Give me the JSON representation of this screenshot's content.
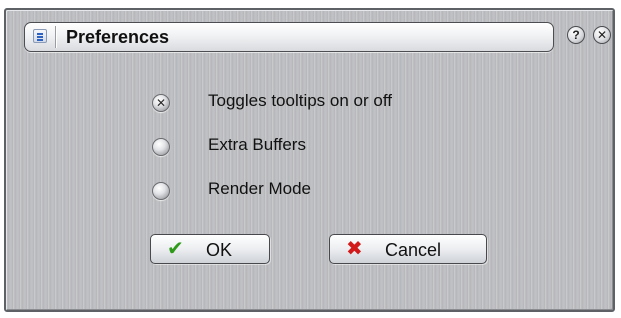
{
  "window": {
    "title": "Preferences"
  },
  "title_buttons": {
    "help_glyph": "?",
    "close_glyph": "✕",
    "help_icon": "question-circle-icon",
    "close_icon": "close-circle-icon"
  },
  "options": [
    {
      "label": "Toggles tooltips on or off",
      "selected": true
    },
    {
      "label": "Extra Buffers",
      "selected": false
    },
    {
      "label": "Render Mode",
      "selected": false
    }
  ],
  "buttons": {
    "ok_label": "OK",
    "ok_icon": "checkmark-icon",
    "ok_glyph": "✔",
    "cancel_label": "Cancel",
    "cancel_icon": "x-icon",
    "cancel_glyph": "✖"
  },
  "colors": {
    "ok_icon": "#2f9a1a",
    "cancel_icon": "#d21a1a",
    "menu_icon": "#2c62c4"
  }
}
